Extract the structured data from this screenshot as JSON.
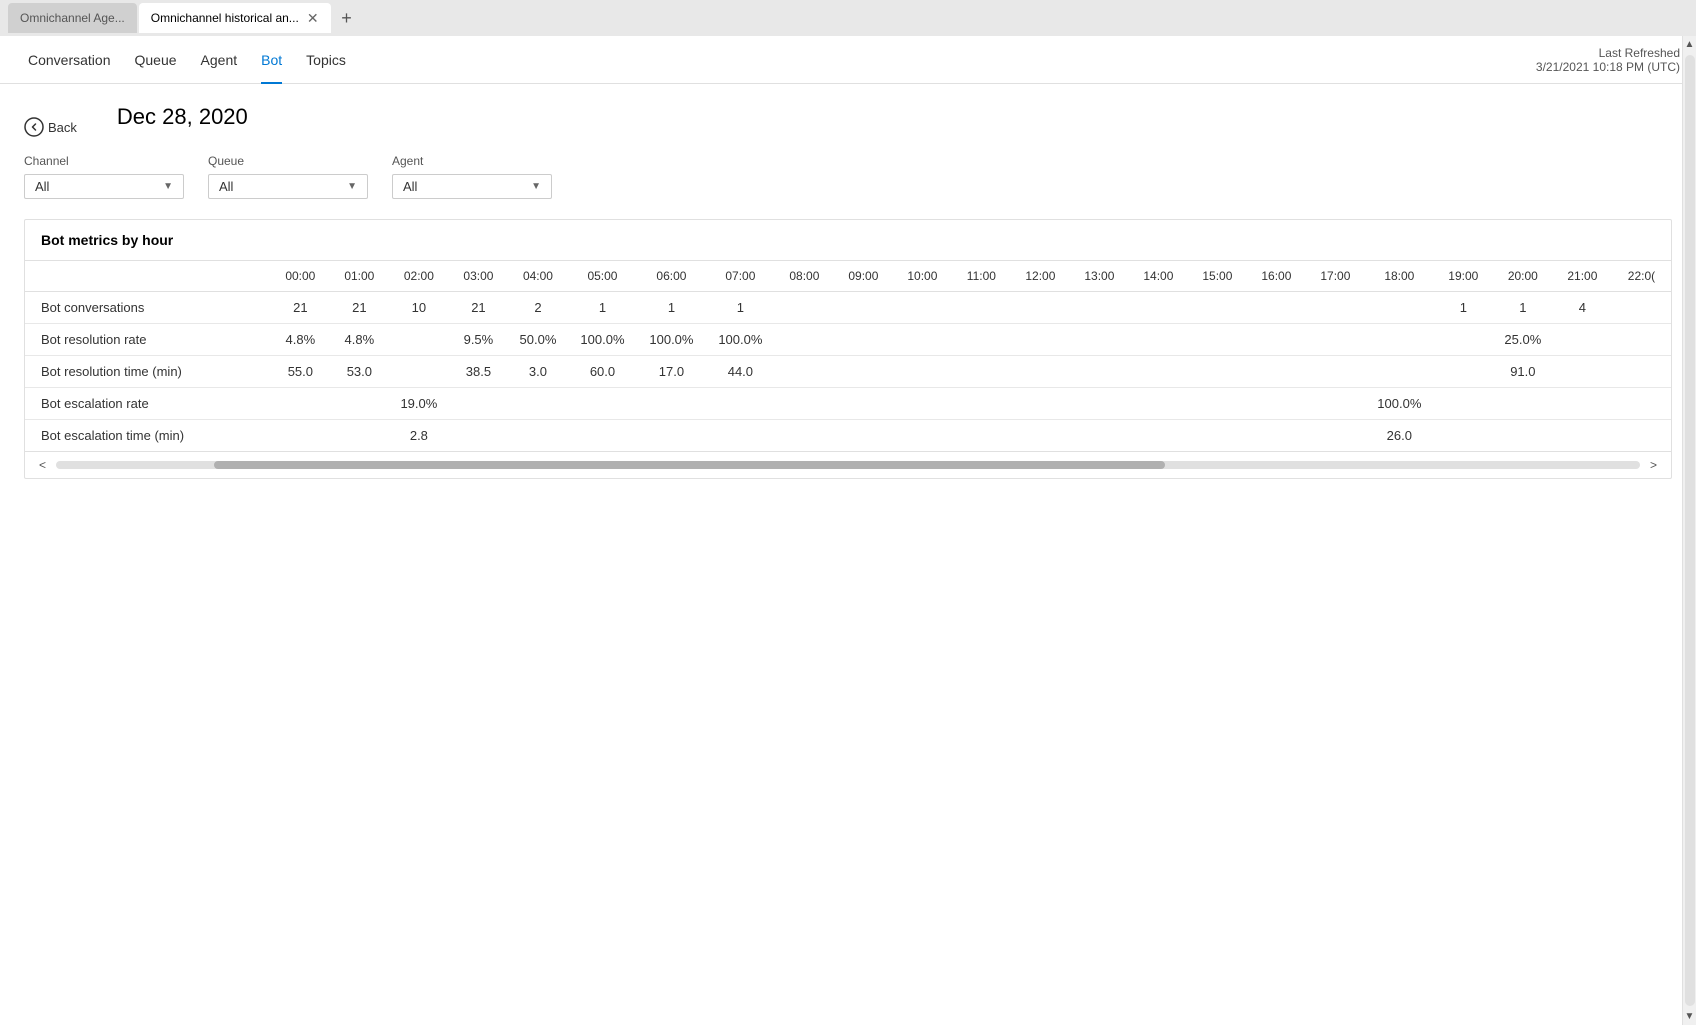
{
  "browser": {
    "tabs": [
      {
        "id": "tab1",
        "label": "Omnichannel Age...",
        "active": false
      },
      {
        "id": "tab2",
        "label": "Omnichannel historical an...",
        "active": true
      }
    ],
    "add_tab_label": "+"
  },
  "nav": {
    "items": [
      {
        "id": "conversation",
        "label": "Conversation",
        "active": false
      },
      {
        "id": "queue",
        "label": "Queue",
        "active": false
      },
      {
        "id": "agent",
        "label": "Agent",
        "active": false
      },
      {
        "id": "bot",
        "label": "Bot",
        "active": true
      },
      {
        "id": "topics",
        "label": "Topics",
        "active": false
      }
    ],
    "last_refreshed_label": "Last Refreshed",
    "last_refreshed_value": "3/21/2021 10:18 PM (UTC)"
  },
  "page": {
    "back_label": "Back",
    "title": "Dec 28, 2020"
  },
  "filters": {
    "channel": {
      "label": "Channel",
      "value": "All"
    },
    "queue": {
      "label": "Queue",
      "value": "All"
    },
    "agent": {
      "label": "Agent",
      "value": "All"
    }
  },
  "metrics_card": {
    "title": "Bot metrics by hour",
    "hours": [
      "00:00",
      "01:00",
      "02:00",
      "03:00",
      "04:00",
      "05:00",
      "06:00",
      "07:00",
      "08:00",
      "09:00",
      "10:00",
      "11:00",
      "12:00",
      "13:00",
      "14:00",
      "15:00",
      "16:00",
      "17:00",
      "18:00",
      "19:00",
      "20:00",
      "21:00",
      "22:0("
    ],
    "rows": [
      {
        "label": "Bot conversations",
        "values": [
          "21",
          "21",
          "10",
          "21",
          "2",
          "1",
          "1",
          "1",
          "",
          "",
          "",
          "",
          "",
          "",
          "",
          "",
          "",
          "",
          "",
          "1",
          "1",
          "4",
          ""
        ]
      },
      {
        "label": "Bot resolution rate",
        "values": [
          "4.8%",
          "4.8%",
          "",
          "9.5%",
          "50.0%",
          "100.0%",
          "100.0%",
          "100.0%",
          "",
          "",
          "",
          "",
          "",
          "",
          "",
          "",
          "",
          "",
          "",
          "",
          "25.0%",
          "",
          ""
        ]
      },
      {
        "label": "Bot resolution time (min)",
        "values": [
          "55.0",
          "53.0",
          "",
          "38.5",
          "3.0",
          "60.0",
          "17.0",
          "44.0",
          "",
          "",
          "",
          "",
          "",
          "",
          "",
          "",
          "",
          "",
          "",
          "",
          "91.0",
          "",
          ""
        ]
      },
      {
        "label": "Bot escalation rate",
        "values": [
          "",
          "",
          "19.0%",
          "",
          "",
          "",
          "",
          "",
          "",
          "",
          "",
          "",
          "",
          "",
          "",
          "",
          "",
          "",
          "100.0%",
          "",
          "",
          "",
          ""
        ]
      },
      {
        "label": "Bot escalation time (min)",
        "values": [
          "",
          "",
          "2.8",
          "",
          "",
          "",
          "",
          "",
          "",
          "",
          "",
          "",
          "",
          "",
          "",
          "",
          "",
          "",
          "26.0",
          "",
          "",
          "",
          ""
        ]
      }
    ]
  }
}
